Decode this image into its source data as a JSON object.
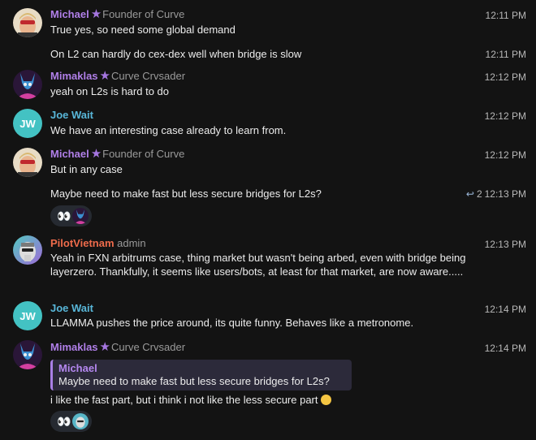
{
  "messages": [
    {
      "name": "Michael",
      "title": "Founder of Curve",
      "time": "12:11 PM",
      "text": "True yes, so need some global demand"
    },
    {
      "time": "12:11 PM",
      "text": "On L2 can hardly do cex-dex well when bridge is slow"
    },
    {
      "name": "Mimaklas",
      "title": "Curve Crvsader",
      "time": "12:12 PM",
      "text": "yeah on L2s is hard to do"
    },
    {
      "name": "Joe Wait",
      "initials": "JW",
      "time": "12:12 PM",
      "text": "We have an interesting case already to learn from."
    },
    {
      "name": "Michael",
      "title": "Founder of Curve",
      "time": "12:12 PM",
      "text": "But in any case"
    },
    {
      "time": "12:13 PM",
      "text": "Maybe need to make fast but less secure bridges for L2s?",
      "reply_count": "2",
      "reaction": "👀"
    },
    {
      "name": "PilotVietnam",
      "title": "admin",
      "time": "12:13 PM",
      "text": "Yeah in FXN arbitrums case, thing market but wasn't being arbed, even with bridge being layerzero. Thankfully, it seems like users/bots, at least for that market, are now aware....."
    },
    {
      "name": "Joe Wait",
      "initials": "JW",
      "time": "12:14 PM",
      "text": "LLAMMA pushes the price around, its quite funny. Behaves like a metronome."
    },
    {
      "name": "Mimaklas",
      "title": "Curve Crvsader",
      "time": "12:14 PM",
      "quote_name": "Michael",
      "quote_text": "Maybe need to make fast but less secure bridges for L2s?",
      "text": "i like the fast part, but i think i not like the less secure part",
      "reaction": "👀"
    }
  ],
  "colors": {
    "background": "#131313",
    "purple_name": "#b07fe8",
    "blue_name": "#58b6d8",
    "red_name": "#ee6b4b",
    "reaction_pill": "#262a31"
  }
}
